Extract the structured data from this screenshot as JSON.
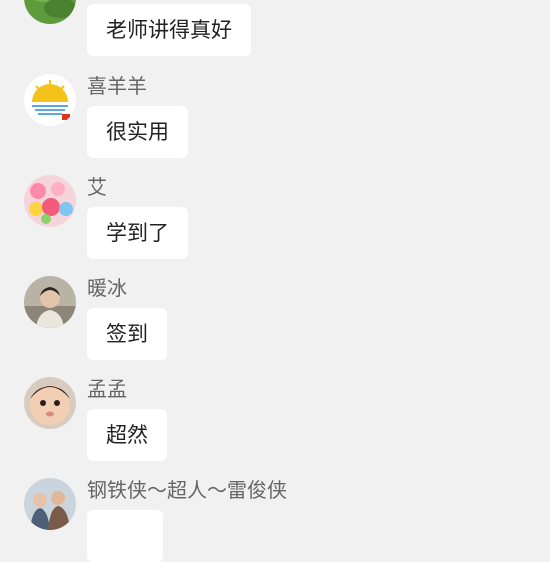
{
  "messages": [
    {
      "name": "",
      "text": "老师讲得真好",
      "avatar": "green-leaf-avatar"
    },
    {
      "name": "喜羊羊",
      "text": "很实用",
      "avatar": "sunrise-logo-avatar"
    },
    {
      "name": "艾",
      "text": "学到了",
      "avatar": "colorful-toys-avatar"
    },
    {
      "name": "暖冰",
      "text": "签到",
      "avatar": "person-photo-avatar"
    },
    {
      "name": "孟孟",
      "text": "超然",
      "avatar": "baby-photo-avatar"
    },
    {
      "name": "钢铁侠～超人～雷俊侠",
      "text": "",
      "avatar": "group-photo-avatar"
    }
  ],
  "colors": {
    "background": "#f1f1f1",
    "bubble": "#ffffff",
    "name_text": "#666666",
    "message_text": "#222222"
  }
}
